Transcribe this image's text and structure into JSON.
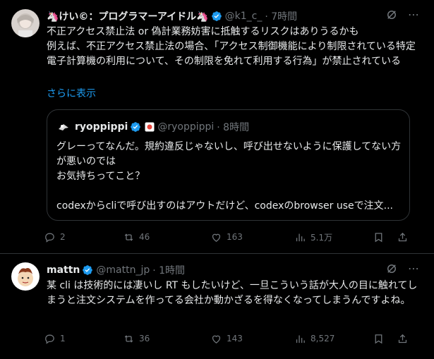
{
  "tweets": [
    {
      "author": {
        "name": "🦄けい©：プログラマーアイドル🦄",
        "handle": "@k1_c_",
        "time": "· 7時間"
      },
      "text": "不正アクセス禁止法 or 偽計業務妨害に抵触するリスクはありうるかも\n例えば、不正アクセス禁止法の場合、「アクセス制御機能により制限されている特定電子計算機の利用について、その制限を免れて利用する行為」が禁止されている",
      "show_more": "さらに表示",
      "quote": {
        "author": {
          "name": "ryoppippi",
          "handle": "@ryoppippi",
          "time": "· 8時間"
        },
        "text": "グレーってなんだ。規約違反じゃないし、呼び出せないように保護してない方が悪いのでは\nお気持ちってこと？\n\ncodexからcliで呼び出すのはアウトだけど、codexのbrowser useで注文..."
      },
      "stats": {
        "replies": "2",
        "retweets": "46",
        "likes": "163",
        "views": "5.1万"
      }
    },
    {
      "author": {
        "name": "mattn",
        "handle": "@mattn_jp",
        "time": "· 1時間"
      },
      "text": "某 cli は技術的には凄いし RT もしたいけど、一旦こういう話が大人の目に触れてしまうと注文システムを作ってる会社か動かざるを得なくなってしまうんですよね。",
      "stats": {
        "replies": "1",
        "retweets": "36",
        "likes": "143",
        "views": "8,527"
      }
    }
  ],
  "colors": {
    "background": "#000000",
    "text": "#e7e9ea",
    "muted": "#71767b",
    "accent": "#1d9bf0",
    "border": "#2f3336"
  },
  "icons": [
    "verified-badge-icon",
    "grok-icon",
    "more-icon",
    "reply-icon",
    "retweet-icon",
    "like-icon",
    "views-icon",
    "bookmark-icon",
    "share-icon"
  ]
}
